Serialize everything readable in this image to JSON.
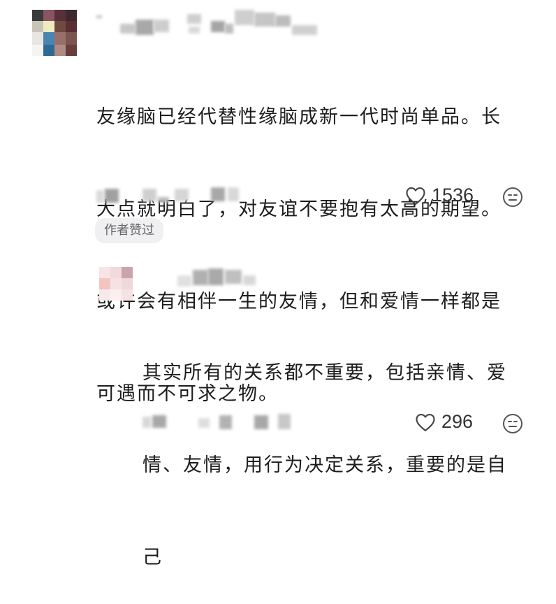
{
  "comments": [
    {
      "text": "友缘脑已经代替性缘脑成新一代时尚单品。长大点就明白了，对友谊不要抱有太高的期望。或许会有相伴一生的友情，但和爱情一样都是可遇而不可求之物。",
      "lines": [
        "友缘脑已经代替性缘脑成新一代时尚单品。长",
        "大点就明白了，对友谊不要抱有太高的期望。",
        "或许会有相伴一生的友情，但和爱情一样都是",
        "可遇而不可求之物。"
      ],
      "likes": "1536",
      "badge": "作者赞过"
    },
    {
      "lines": [
        "其实所有的关系都不重要，包括亲情、爱",
        "情、友情，用行为决定关系，重要的是自",
        "己"
      ],
      "likes": "296"
    }
  ],
  "icons": {
    "like": "heart-outline-icon",
    "reaction": "neutral-face-icon"
  }
}
